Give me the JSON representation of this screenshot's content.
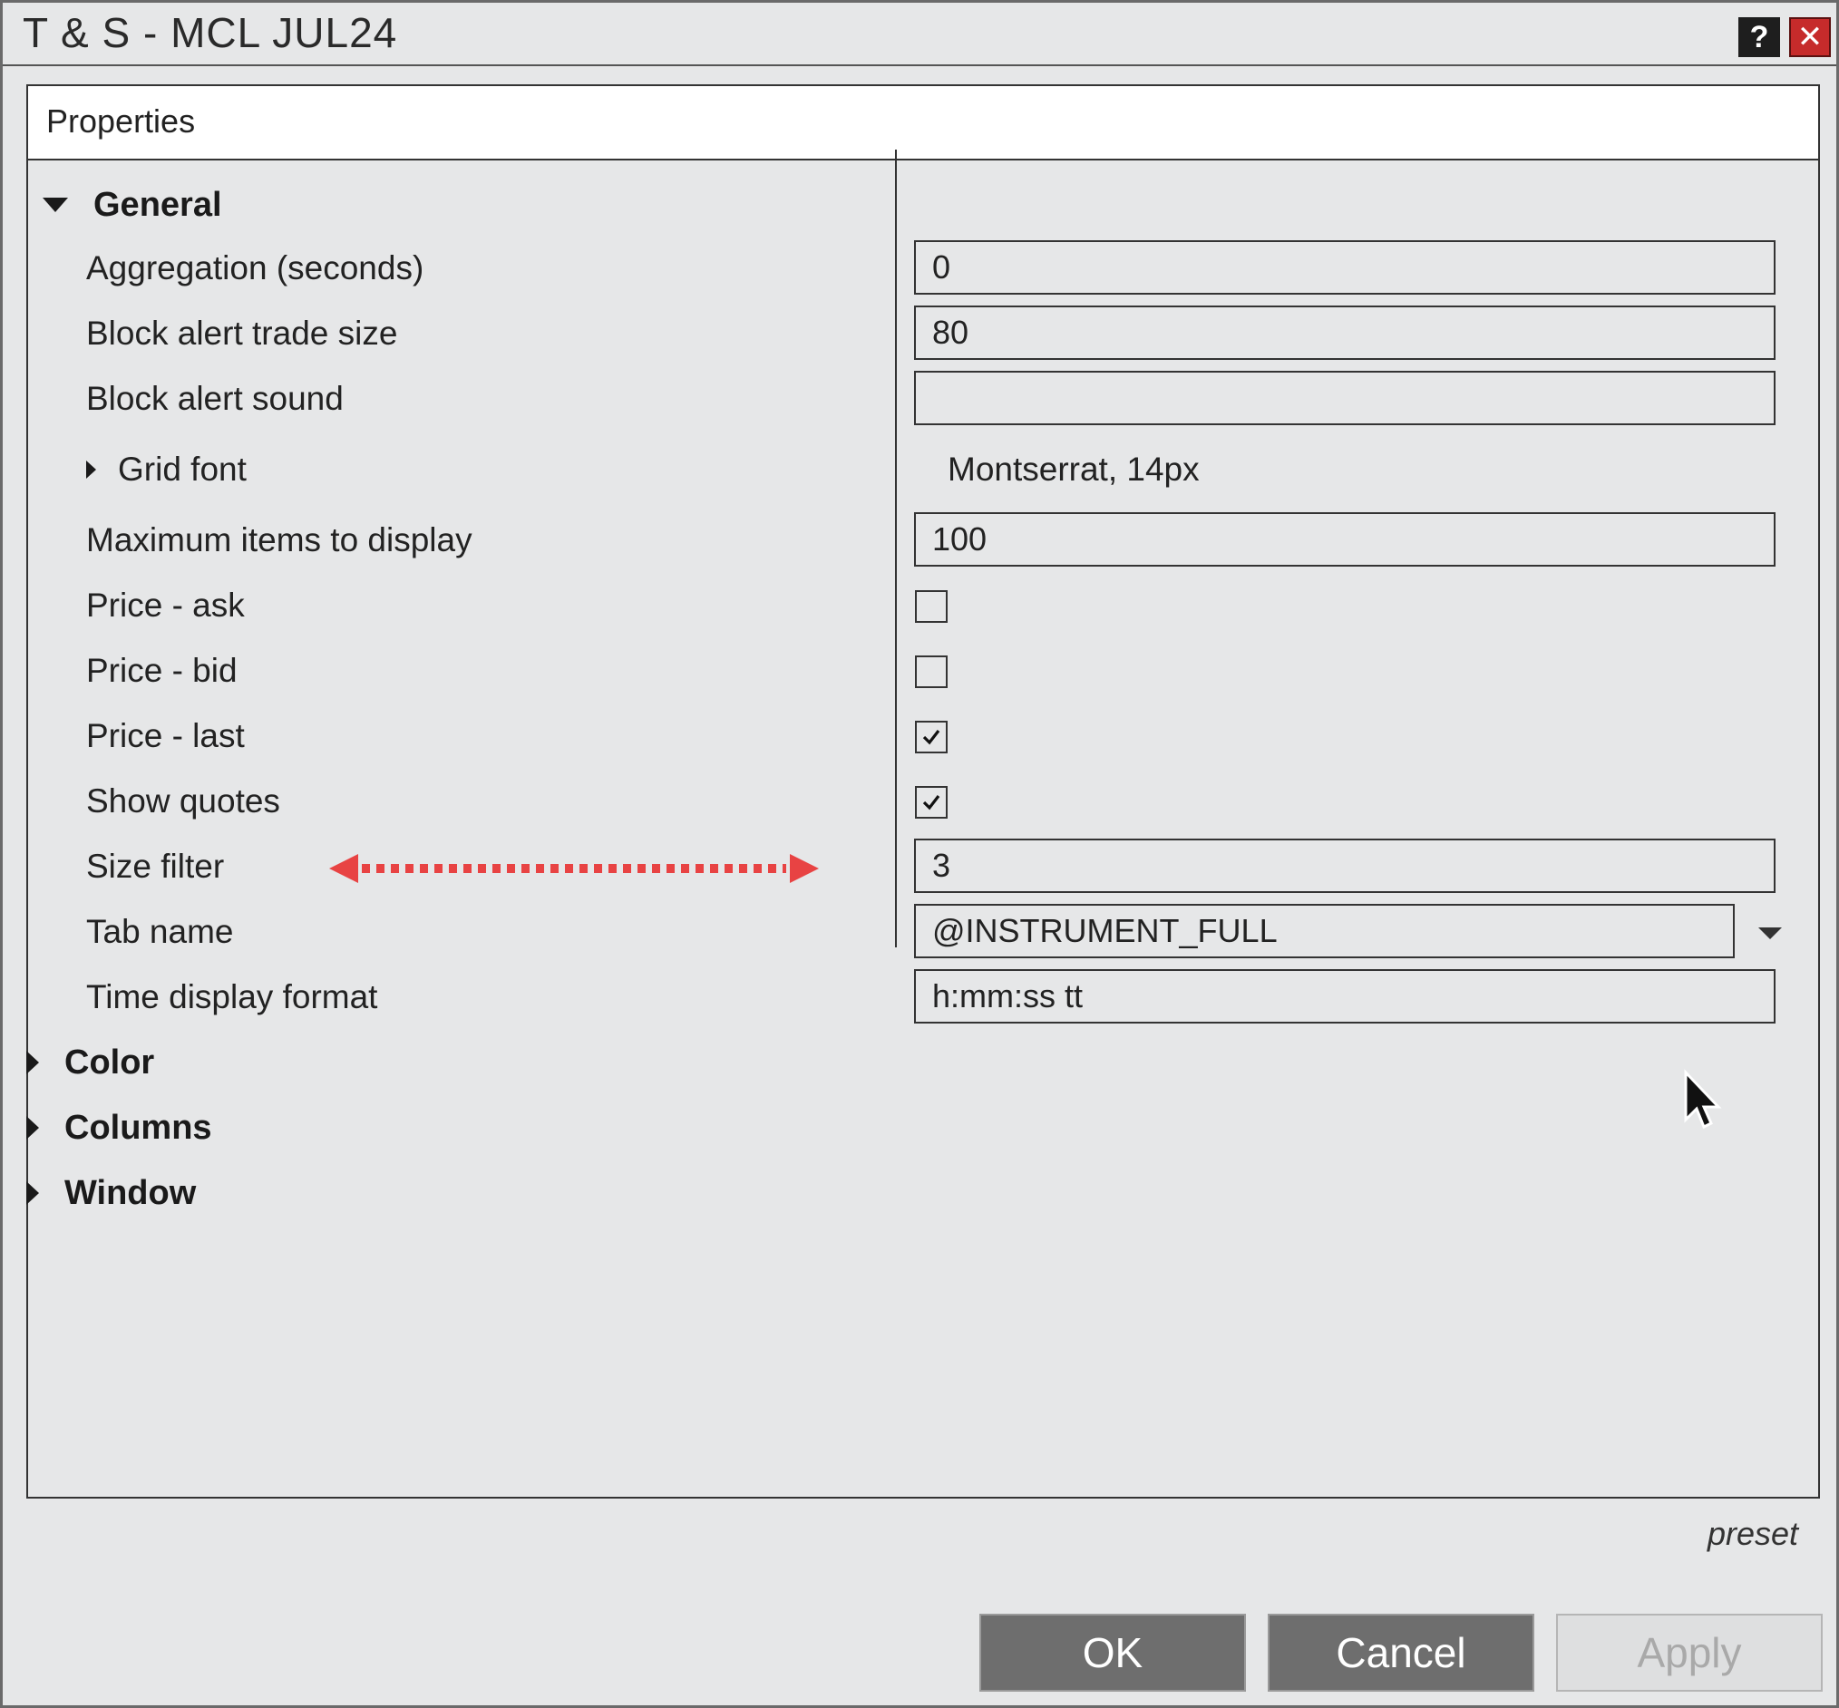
{
  "window": {
    "title": "T & S - MCL JUL24",
    "help_label": "?",
    "close_label": "✕"
  },
  "panel": {
    "header": "Properties"
  },
  "general": {
    "label": "General",
    "properties": {
      "aggregation": {
        "label": "Aggregation (seconds)",
        "value": "0"
      },
      "block_alert_trade_size": {
        "label": "Block alert trade size",
        "value": "80"
      },
      "block_alert_sound": {
        "label": "Block alert sound",
        "value": ""
      },
      "grid_font": {
        "label": "Grid font",
        "value": "Montserrat, 14px"
      },
      "max_items": {
        "label": "Maximum items to display",
        "value": "100"
      },
      "price_ask": {
        "label": "Price - ask",
        "checked": false
      },
      "price_bid": {
        "label": "Price - bid",
        "checked": false
      },
      "price_last": {
        "label": "Price - last",
        "checked": true
      },
      "show_quotes": {
        "label": "Show quotes",
        "checked": true
      },
      "size_filter": {
        "label": "Size filter",
        "value": "3"
      },
      "tab_name": {
        "label": "Tab name",
        "value": "@INSTRUMENT_FULL"
      },
      "time_format": {
        "label": "Time display format",
        "value": "h:mm:ss tt"
      }
    }
  },
  "groups": {
    "color": "Color",
    "columns": "Columns",
    "window": "Window"
  },
  "footer": {
    "preset": "preset",
    "ok": "OK",
    "cancel": "Cancel",
    "apply": "Apply"
  },
  "colors": {
    "annotation_arrow": "#e84343",
    "close_button": "#c62b2b",
    "button_bg": "#6e6e6e"
  },
  "icons": {
    "help": "question-icon",
    "close": "close-icon",
    "expand": "triangle-right-icon",
    "collapse": "triangle-down-icon",
    "dropdown": "chevron-down-icon",
    "check": "checkmark-icon",
    "cursor": "mouse-pointer-icon",
    "annotation": "double-arrow-icon"
  }
}
